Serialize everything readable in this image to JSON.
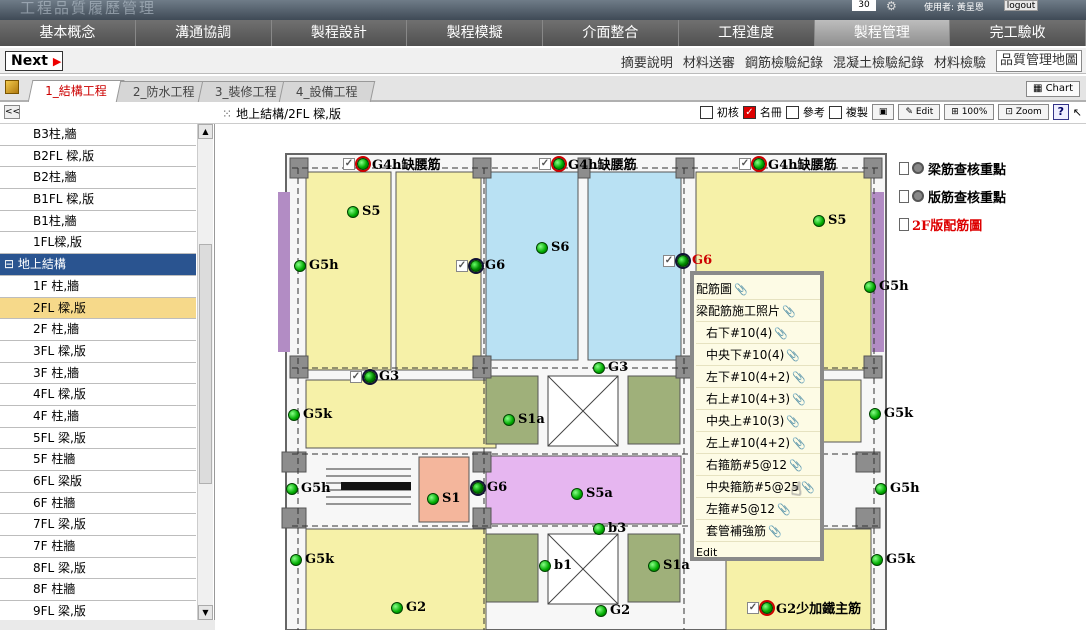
{
  "banner": {
    "logo_text": "工程品質履歷管理",
    "zoom_value": "30",
    "user_text": "使用者: 黃呈恩",
    "logout_label": "logout"
  },
  "main_nav": [
    "基本概念",
    "溝通協調",
    "製程設計",
    "製程模擬",
    "介面整合",
    "工程進度",
    "製程管理",
    "完工驗收"
  ],
  "main_nav_active": 6,
  "sub_nav": {
    "next_label": "Next",
    "items": [
      "摘要說明",
      "材料送審",
      "鋼筋檢驗紀錄",
      "混凝土檢驗紀錄",
      "材料檢驗",
      "品質管理地圖"
    ],
    "active": 5
  },
  "tabs": {
    "items": [
      "1_結構工程",
      "2_防水工程",
      "3_裝修工程",
      "4_設備工程"
    ],
    "active": 0,
    "chart_label": "Chart"
  },
  "toolbar": {
    "collapse_label": "<<",
    "path": "地上結構/2FL 樑,版",
    "check_initial": "初核",
    "check_sign": "名冊",
    "check_ref": "參考",
    "check_review": "複製",
    "edit_label": "Edit",
    "zoom_pct": "100%",
    "zoom_label": "Zoom",
    "help_label": "?"
  },
  "sidebar": {
    "items": [
      {
        "label": "B3柱,牆",
        "type": "item"
      },
      {
        "label": "B2FL 樑,版",
        "type": "item"
      },
      {
        "label": "B2柱,牆",
        "type": "item"
      },
      {
        "label": "B1FL 樑,版",
        "type": "item"
      },
      {
        "label": "B1柱,牆",
        "type": "item"
      },
      {
        "label": "1FL樑,版",
        "type": "item"
      },
      {
        "label": "⊟ 地上結構",
        "type": "grp"
      },
      {
        "label": "1F 柱,牆",
        "type": "item"
      },
      {
        "label": "2FL 樑,版",
        "type": "sel"
      },
      {
        "label": "2F 柱,牆",
        "type": "item"
      },
      {
        "label": "3FL 樑,版",
        "type": "item"
      },
      {
        "label": "3F 柱,牆",
        "type": "item"
      },
      {
        "label": "4FL 樑,版",
        "type": "item"
      },
      {
        "label": "4F 柱,牆",
        "type": "item"
      },
      {
        "label": "5FL 梁,版",
        "type": "item"
      },
      {
        "label": "5F 柱牆",
        "type": "item"
      },
      {
        "label": "6FL 梁版",
        "type": "item"
      },
      {
        "label": "6F 柱牆",
        "type": "item"
      },
      {
        "label": "7FL 梁,版",
        "type": "item"
      },
      {
        "label": "7F 柱牆",
        "type": "item"
      },
      {
        "label": "8FL 梁,版",
        "type": "item"
      },
      {
        "label": "8F 柱牆",
        "type": "item"
      },
      {
        "label": "9FL 梁,版",
        "type": "item"
      }
    ]
  },
  "legend": [
    "梁筋查核重點",
    "版筋查核重點",
    "2F版配筋圖"
  ],
  "markers": {
    "g4h_1": "G4h缺腰筋",
    "g4h_2": "G4h缺腰筋",
    "g4h_3": "G4h缺腰筋",
    "s5_l": "S5",
    "s5_r": "S5",
    "s6": "S6",
    "g5h_l": "G5h",
    "g6_a": "G6",
    "g6_b": "G6",
    "g5h_r": "G5h",
    "g3_a": "G3",
    "g3_b": "G3",
    "g5k_l": "G5k",
    "s1a_a": "S1a",
    "g5k_r": "G5k",
    "g5h_bl": "G5h",
    "s1": "S1",
    "g6_c": "G6",
    "s5a": "S5a",
    "g5h_br": "G5h",
    "b3": "b3",
    "g5k_bl": "G5k",
    "b1": "b1",
    "s1a_b": "S1a",
    "g5k_br": "G5k",
    "g2_a": "G2",
    "g2_b": "G2",
    "g2_r": "G2少加鐵主筋"
  },
  "popup": {
    "items": [
      {
        "label": "配筋圖",
        "sub": false
      },
      {
        "label": "梁配筋施工照片",
        "sub": false
      },
      {
        "label": "右下#10(4)",
        "sub": true
      },
      {
        "label": "中央下#10(4)",
        "sub": true
      },
      {
        "label": "左下#10(4+2)",
        "sub": true
      },
      {
        "label": "右上#10(4+3)",
        "sub": true
      },
      {
        "label": "中央上#10(3)",
        "sub": true
      },
      {
        "label": "左上#10(4+2)",
        "sub": true
      },
      {
        "label": "右箍筋#5@12",
        "sub": true
      },
      {
        "label": "中央箍筋#5@25",
        "sub": true
      },
      {
        "label": "左箍#5@12",
        "sub": true
      },
      {
        "label": "套管補強筋",
        "sub": true
      }
    ],
    "edit_label": "Edit"
  }
}
